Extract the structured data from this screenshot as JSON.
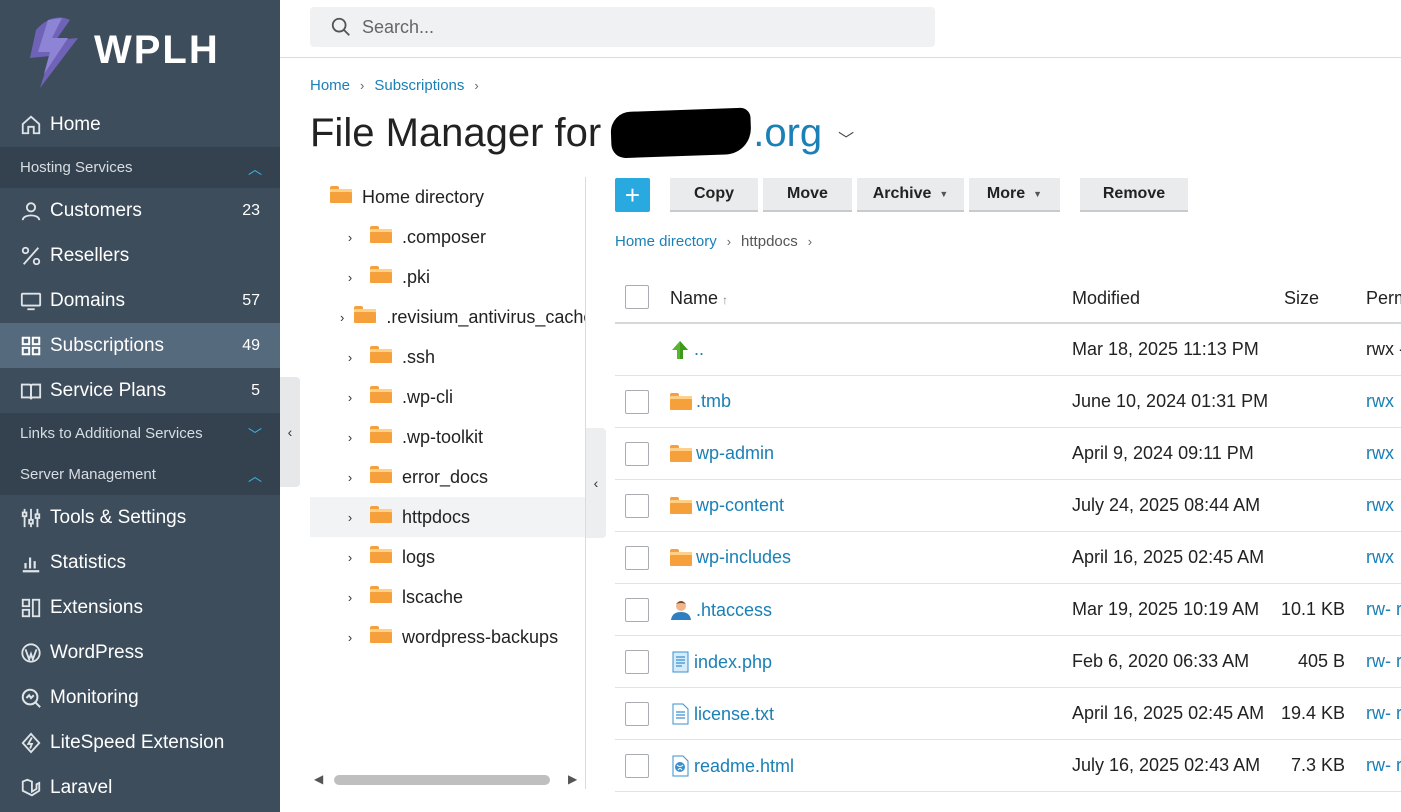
{
  "brand": {
    "name": "WPLH"
  },
  "sidebar": {
    "items": [
      {
        "label": "Home",
        "icon": "home-icon",
        "count": ""
      },
      {
        "label": "Customers",
        "icon": "user-icon",
        "count": "23"
      },
      {
        "label": "Resellers",
        "icon": "percent-icon",
        "count": ""
      },
      {
        "label": "Domains",
        "icon": "monitor-icon",
        "count": "57"
      },
      {
        "label": "Subscriptions",
        "icon": "grid-icon",
        "count": "49",
        "active": true
      },
      {
        "label": "Service Plans",
        "icon": "book-icon",
        "count": "5"
      },
      {
        "label": "Tools & Settings",
        "icon": "tools-icon",
        "count": ""
      },
      {
        "label": "Statistics",
        "icon": "bar-chart-icon",
        "count": ""
      },
      {
        "label": "Extensions",
        "icon": "extensions-icon",
        "count": ""
      },
      {
        "label": "WordPress",
        "icon": "wordpress-icon",
        "count": ""
      },
      {
        "label": "Monitoring",
        "icon": "monitoring-icon",
        "count": ""
      },
      {
        "label": "LiteSpeed Extension",
        "icon": "litespeed-icon",
        "count": ""
      },
      {
        "label": "Laravel",
        "icon": "laravel-icon",
        "count": ""
      }
    ],
    "sections": [
      {
        "label": "Hosting Services",
        "state": "expanded"
      },
      {
        "label": "Links to Additional Services",
        "state": "collapsed"
      },
      {
        "label": "Server Management",
        "state": "expanded"
      }
    ]
  },
  "search": {
    "placeholder": "Search..."
  },
  "breadcrumb": {
    "items": [
      "Home",
      "Subscriptions"
    ]
  },
  "page": {
    "title_prefix": "File Manager for",
    "domain_suffix": ".org"
  },
  "tree": {
    "root": "Home directory",
    "items": [
      ".composer",
      ".pki",
      ".revisium_antivirus_cache",
      ".ssh",
      ".wp-cli",
      ".wp-toolkit",
      "error_docs",
      "httpdocs",
      "logs",
      "lscache",
      "wordpress-backups"
    ],
    "selected": "httpdocs"
  },
  "toolbar": {
    "add": "+",
    "copy": "Copy",
    "move": "Move",
    "archive": "Archive",
    "more": "More",
    "remove": "Remove"
  },
  "file_breadcrumb": {
    "root": "Home directory",
    "current": "httpdocs"
  },
  "table": {
    "headers": {
      "name": "Name",
      "modified": "Modified",
      "size": "Size",
      "perm": "Perm"
    },
    "rows": [
      {
        "name": "..",
        "type": "up",
        "modified": "Mar 18, 2025 11:13 PM",
        "size": "",
        "perm": "rwx -"
      },
      {
        "name": ".tmb",
        "type": "folder",
        "modified": "June 10, 2024 01:31 PM",
        "size": "",
        "perm": "rwx"
      },
      {
        "name": "wp-admin",
        "type": "folder",
        "modified": "April 9, 2024 09:11 PM",
        "size": "",
        "perm": "rwx"
      },
      {
        "name": "wp-content",
        "type": "folder",
        "modified": "July 24, 2025 08:44 AM",
        "size": "",
        "perm": "rwx"
      },
      {
        "name": "wp-includes",
        "type": "folder",
        "modified": "April 16, 2025 02:45 AM",
        "size": "",
        "perm": "rwx"
      },
      {
        "name": ".htaccess",
        "type": "user-file",
        "modified": "Mar 19, 2025 10:19 AM",
        "size": "10.1 KB",
        "perm": "rw- r"
      },
      {
        "name": "index.php",
        "type": "script-file",
        "modified": "Feb 6, 2020 06:33 AM",
        "size": "405 B",
        "perm": "rw- r"
      },
      {
        "name": "license.txt",
        "type": "text-file",
        "modified": "April 16, 2025 02:45 AM",
        "size": "19.4 KB",
        "perm": "rw- r"
      },
      {
        "name": "readme.html",
        "type": "html-file",
        "modified": "July 16, 2025 02:43 AM",
        "size": "7.3 KB",
        "perm": "rw- r"
      }
    ]
  },
  "colors": {
    "sidebar_bg": "#3d4d5c",
    "active_bg": "#566a7d",
    "link": "#1a80b6",
    "accent": "#28aae1",
    "folder": "#f5a03a"
  }
}
